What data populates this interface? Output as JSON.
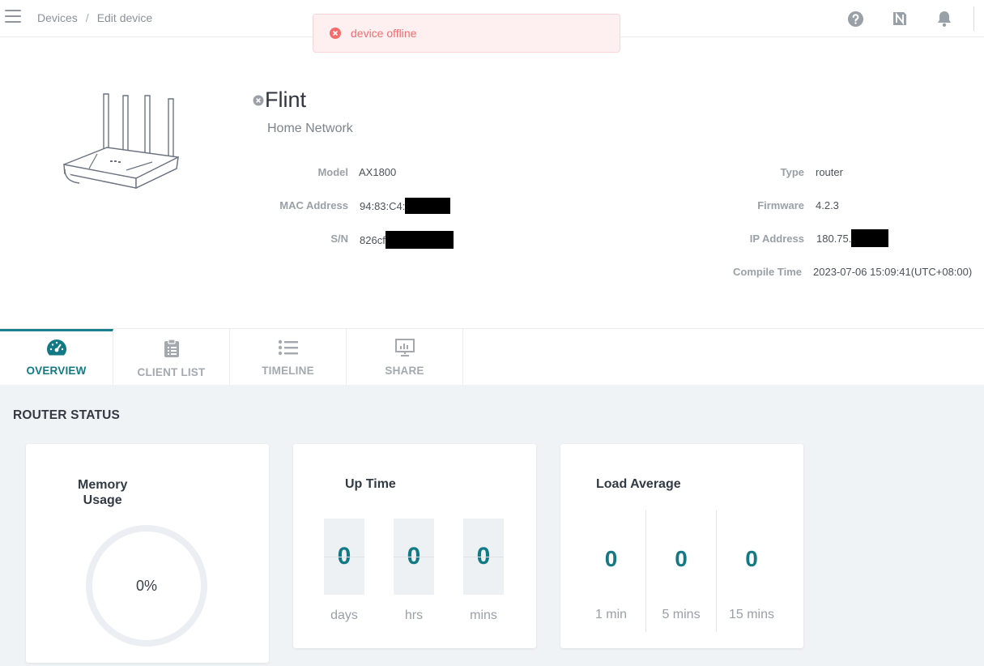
{
  "breadcrumb": {
    "root": "Devices",
    "separator": "/",
    "current": "Edit device"
  },
  "toast": {
    "message": "device offline",
    "color": "#f56c6c"
  },
  "device": {
    "name": "Flint",
    "group": "Home Network",
    "left_fields": [
      {
        "label": "Model",
        "value": "AX1800"
      },
      {
        "label": "MAC Address",
        "value": "94:83:C4:"
      },
      {
        "label": "S/N",
        "value": "826cf"
      }
    ],
    "right_fields": [
      {
        "label": "Type",
        "value": "router"
      },
      {
        "label": "Firmware",
        "value": "4.2.3"
      },
      {
        "label": "IP Address",
        "value": "180.75."
      },
      {
        "label": "Compile Time",
        "value": "2023-07-06 15:09:41(UTC+08:00)"
      }
    ]
  },
  "tabs": [
    {
      "label": "OVERVIEW",
      "icon": "dashboard-gauge-icon",
      "active": true
    },
    {
      "label": "CLIENT LIST",
      "icon": "clipboard-icon",
      "active": false
    },
    {
      "label": "TIMELINE",
      "icon": "list-icon",
      "active": false
    },
    {
      "label": "SHARE",
      "icon": "presentation-chart-icon",
      "active": false
    }
  ],
  "router_status": {
    "title": "ROUTER STATUS",
    "memory": {
      "title_line1": "Memory",
      "title_line2": "Usage",
      "value": "0%",
      "percent": 0
    },
    "uptime": {
      "title": "Up Time",
      "days": "0",
      "hrs": "0",
      "mins": "0",
      "days_label": "days",
      "hrs_label": "hrs",
      "mins_label": "mins"
    },
    "load": {
      "title": "Load Average",
      "m1": "0",
      "m5": "0",
      "m15": "0",
      "m1_label": "1 min",
      "m5_label": "5 mins",
      "m15_label": "15 mins"
    }
  },
  "colors": {
    "accent": "#137a85",
    "error": "#f56c6c"
  }
}
